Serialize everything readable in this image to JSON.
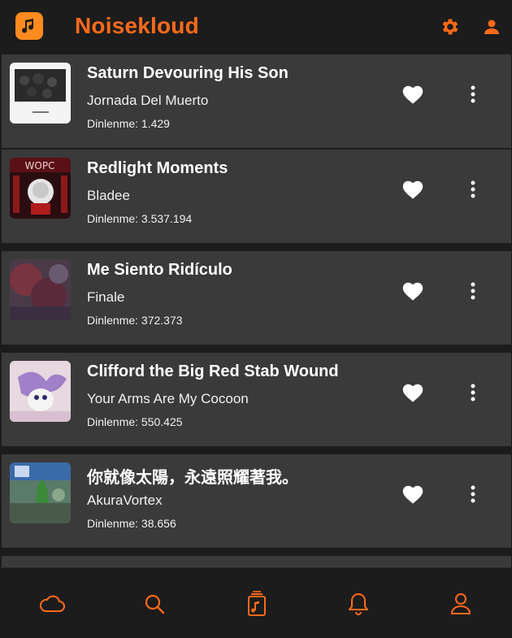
{
  "app": {
    "title": "Noisekloud",
    "accent_color": "#ff6a1a"
  },
  "header": {
    "icons": [
      "settings-gear-icon",
      "user-profile-icon"
    ]
  },
  "songs": [
    {
      "title": "Saturn Devouring His Son",
      "artist": "Jornada Del Muerto",
      "plays": "Dinlenme: 1.429",
      "liked_icon": "heart-icon"
    },
    {
      "title": "Redlight Moments",
      "artist": "Bladee",
      "plays": "Dinlenme: 3.537.194",
      "liked_icon": "heart-icon"
    },
    {
      "title": "Me Siento Ridículo",
      "artist": "Finale",
      "plays": "Dinlenme: 372.373",
      "liked_icon": "heart-icon"
    },
    {
      "title": "Clifford the Big Red Stab Wound",
      "artist": "Your Arms Are My Cocoon",
      "plays": "Dinlenme: 550.425",
      "liked_icon": "heart-icon"
    },
    {
      "title": "你就像太陽，永遠照耀著我。",
      "artist": "AkuraVortex",
      "plays": "Dinlenme: 38.656",
      "liked_icon": "heart-icon"
    }
  ],
  "bottom_nav": {
    "items": [
      "cloud-icon",
      "search-icon",
      "music-library-icon",
      "bell-notification-icon",
      "profile-icon"
    ]
  }
}
